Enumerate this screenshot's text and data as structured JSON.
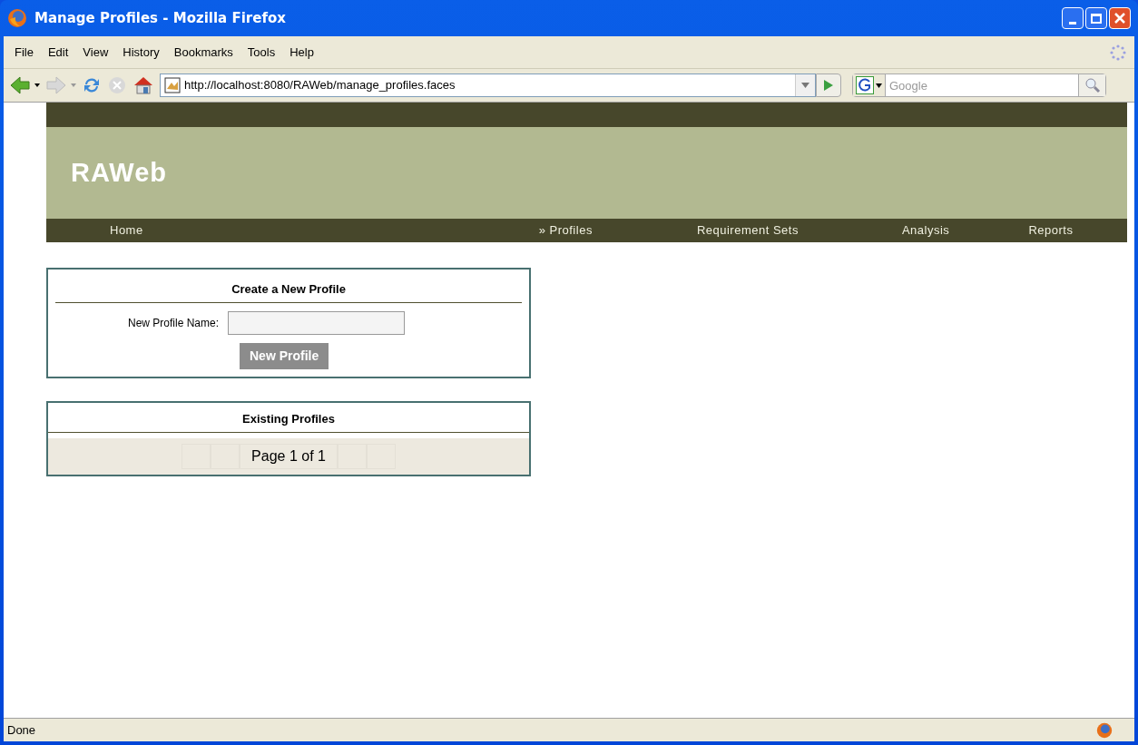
{
  "window": {
    "title": "Manage Profiles - Mozilla Firefox"
  },
  "menu": [
    "File",
    "Edit",
    "View",
    "History",
    "Bookmarks",
    "Tools",
    "Help"
  ],
  "address_bar": {
    "url": "http://localhost:8080/RAWeb/manage_profiles.faces"
  },
  "search": {
    "placeholder": "Google"
  },
  "site": {
    "title": "RAWeb",
    "nav": [
      "Home",
      "» Profiles",
      "Requirement Sets",
      "Analysis",
      "Reports"
    ]
  },
  "create_panel": {
    "title": "Create a New Profile",
    "field_label": "New Profile Name:",
    "button": "New Profile"
  },
  "existing_panel": {
    "title": "Existing Profiles",
    "pager": "Page 1 of 1"
  },
  "status_bar": {
    "text": "Done"
  }
}
